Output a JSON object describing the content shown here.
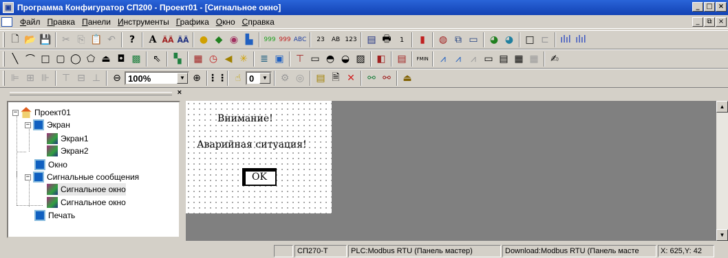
{
  "window": {
    "title": "Программа Конфигуратор СП200   - Проект01 - [Сигнальное окно]",
    "minimize_icon": "minimize-icon",
    "maximize_icon": "maximize-icon",
    "close_icon": "close-icon"
  },
  "menu": {
    "items": [
      "Файл",
      "Правка",
      "Панели",
      "Инструменты",
      "Графика",
      "Окно",
      "Справка"
    ]
  },
  "toolbar3": {
    "zoom_value": "100%",
    "pointer_value": "0"
  },
  "tree": {
    "items": [
      "Проект01",
      "Экран",
      "Экран1",
      "Экран2",
      "Окно",
      "Сигнальные сообщения",
      "Сигнальное окно",
      "Сигнальное окно",
      "Печать"
    ]
  },
  "canvas": {
    "text1": "Внимание!",
    "text2": "Аварийная ситуация!",
    "ok_label": "OK"
  },
  "status": {
    "device": "СП270-Т",
    "plc": "PLC:Modbus RTU (Панель мастер)",
    "download": "Download:Modbus RTU (Панель масте",
    "coords": "X: 625,Y:  42"
  }
}
